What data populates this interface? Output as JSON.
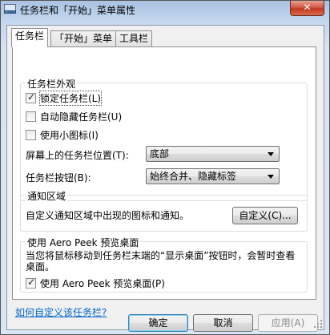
{
  "window": {
    "title": "任务栏和「开始」菜单属性",
    "close_glyph": "✕"
  },
  "tabs": [
    {
      "label": "任务栏",
      "active": true
    },
    {
      "label": "「开始」菜单",
      "active": false
    },
    {
      "label": "工具栏",
      "active": false
    }
  ],
  "appearance": {
    "title": "任务栏外观",
    "lock": {
      "label": "锁定任务栏(L)",
      "checked": true
    },
    "autohide": {
      "label": "自动隐藏任务栏(U)",
      "checked": false
    },
    "small_icons": {
      "label": "使用小图标(I)",
      "checked": false
    },
    "location": {
      "label": "屏幕上的任务栏位置(T):",
      "value": "底部"
    },
    "buttons": {
      "label": "任务栏按钮(B):",
      "value": "始终合并、隐藏标签"
    }
  },
  "notification": {
    "title": "通知区域",
    "text": "自定义通知区域中出现的图标和通知。",
    "customize_button": "自定义(C)..."
  },
  "aero_peek": {
    "title": "使用 Aero Peek 预览桌面",
    "description": "当您将鼠标移动到任务栏末端的“显示桌面”按钮时，会暂时查看桌面。",
    "checkbox": {
      "label": "使用 Aero Peek 预览桌面(P)",
      "checked": true
    }
  },
  "help_link": "如何自定义该任务栏?",
  "footer": {
    "ok": "确定",
    "cancel": "取消",
    "apply": "应用(A)"
  },
  "icons": {
    "check": "✓"
  },
  "colors": {
    "link": "#0066cc",
    "close_button": "#c1391f"
  }
}
